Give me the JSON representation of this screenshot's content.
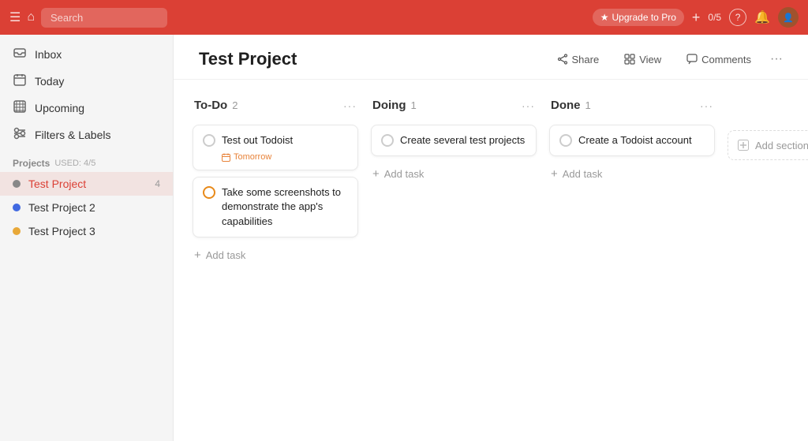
{
  "topnav": {
    "menu_icon": "☰",
    "home_icon": "⌂",
    "search_placeholder": "Search",
    "upgrade_label": "Upgrade to Pro",
    "star_icon": "★",
    "score": "0/5",
    "help_icon": "?",
    "bell_icon": "🔔",
    "add_icon": "+"
  },
  "sidebar": {
    "nav_items": [
      {
        "id": "inbox",
        "label": "Inbox",
        "icon": "📥",
        "count": ""
      },
      {
        "id": "today",
        "label": "Today",
        "icon": "📅",
        "count": ""
      },
      {
        "id": "upcoming",
        "label": "Upcoming",
        "icon": "⊞",
        "count": ""
      },
      {
        "id": "filters",
        "label": "Filters & Labels",
        "icon": "⊟",
        "count": ""
      }
    ],
    "projects_section": "Projects",
    "projects_used_label": "USED: 4/5",
    "projects": [
      {
        "id": "test-project",
        "label": "Test Project",
        "color": "#888888",
        "count": "4",
        "active": true
      },
      {
        "id": "test-project-2",
        "label": "Test Project 2",
        "color": "#4169e1",
        "count": ""
      },
      {
        "id": "test-project-3",
        "label": "Test Project 3",
        "color": "#e8a838",
        "count": ""
      }
    ]
  },
  "page": {
    "title": "Test Project",
    "actions": {
      "share": "Share",
      "view": "View",
      "comments": "Comments"
    }
  },
  "board": {
    "columns": [
      {
        "id": "todo",
        "title": "To-Do",
        "count": "2",
        "tasks": [
          {
            "id": "task-1",
            "text": "Test out Todoist",
            "date": "Tomorrow",
            "date_icon": "📅",
            "checkbox_style": "normal"
          },
          {
            "id": "task-2",
            "text": "Take some screenshots to demonstrate the app's capabilities",
            "date": "",
            "checkbox_style": "orange"
          }
        ],
        "add_task_label": "Add task"
      },
      {
        "id": "doing",
        "title": "Doing",
        "count": "1",
        "tasks": [
          {
            "id": "task-3",
            "text": "Create several test projects",
            "date": "",
            "checkbox_style": "normal"
          }
        ],
        "add_task_label": "Add task"
      },
      {
        "id": "done",
        "title": "Done",
        "count": "1",
        "tasks": [
          {
            "id": "task-4",
            "text": "Create a Todoist account",
            "date": "",
            "checkbox_style": "normal"
          }
        ],
        "add_task_label": "Add task"
      }
    ],
    "add_section_label": "Add section",
    "add_section_icon": "+"
  }
}
